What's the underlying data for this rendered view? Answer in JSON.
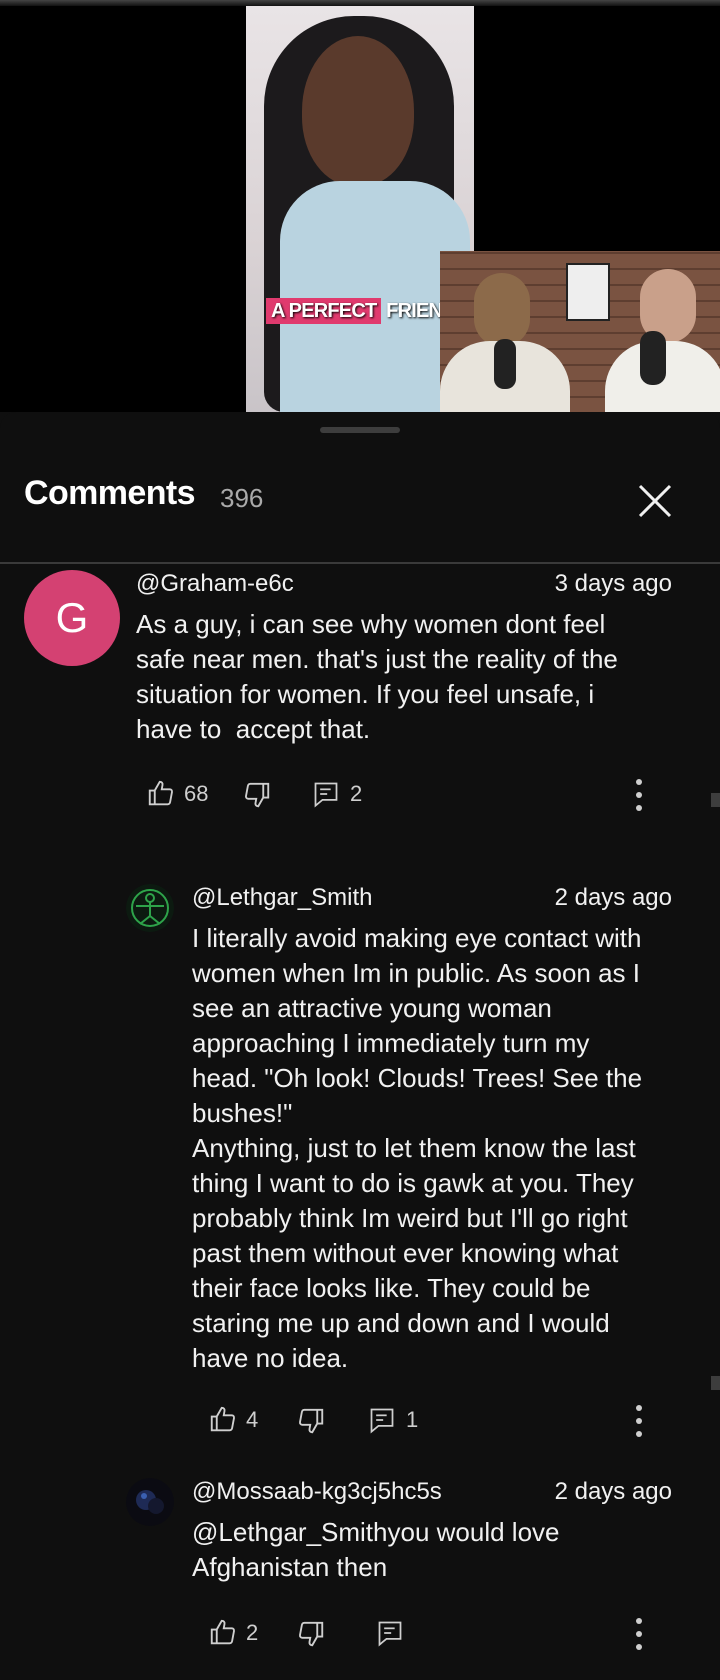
{
  "video": {
    "caption_highlight": "A PERFECT",
    "caption_rest": " FRIENDSHIP"
  },
  "comments_panel": {
    "title": "Comments",
    "count": "396"
  },
  "comments": [
    {
      "author": "@Graham-e6c",
      "avatar_letter": "G",
      "date": "3 days ago",
      "text": "As a guy, i can see why women dont feel\nsafe near men. that's just the reality of the\nsituation for women. If you feel unsafe, i\nhave to  accept that.",
      "likes": "68",
      "replies": "2"
    },
    {
      "author": "@Lethgar_Smith",
      "date": "2 days ago",
      "text": "I literally avoid making eye contact with\nwomen when Im in public. As soon as I\nsee an attractive young woman\napproaching I immediately turn my\nhead. \"Oh look! Clouds! Trees! See the\nbushes!\"\nAnything, just to let them know the last\nthing I want to do is gawk at you. They\nprobably think Im weird but I'll go right\npast them without ever knowing what\ntheir face looks like. They could be\nstaring me up and down and I would\nhave no idea.",
      "likes": "4",
      "replies": "1"
    },
    {
      "author": "@Mossaab-kg3cj5hc5s",
      "date": "2 days ago",
      "text": "@Lethgar_Smithyou would love\nAfghanistan then",
      "likes": "2"
    }
  ],
  "colors": {
    "background": "#0f0f0f",
    "avatar_g": "#d44172",
    "caption_highlight": "#e03a6e"
  }
}
